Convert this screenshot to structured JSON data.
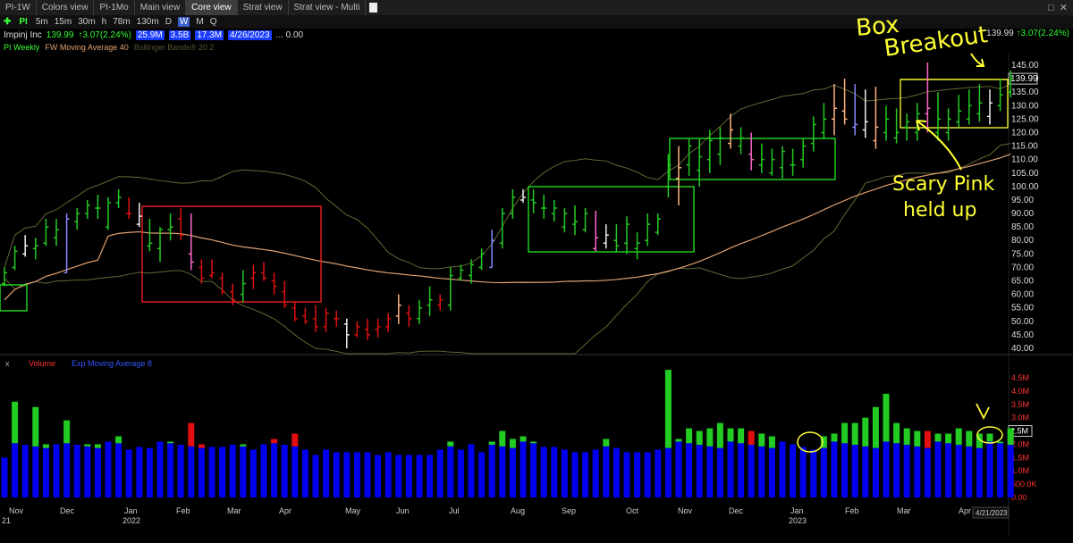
{
  "tabs": [
    "PI-1W",
    "Colors view",
    "PI-1Mo",
    "Main view",
    "Core view",
    "Strat view",
    "Strat view - Multi"
  ],
  "active_tab": 4,
  "toolbar": {
    "symbol": "PI",
    "timeframes": [
      "5m",
      "15m",
      "30m",
      "h",
      "78m",
      "130m",
      "D",
      "W",
      "M",
      "Q"
    ],
    "selected_timeframe": "W"
  },
  "info": {
    "name": "Impinj Inc",
    "last": "139.99",
    "change": "↑3.07(2.24%)",
    "vol1": "25.9M",
    "vol2": "3.5B",
    "vol3": "17.3M",
    "date": "4/26/2023",
    "misc": "... 0.00"
  },
  "indicators_top": [
    "PI Weekly",
    "FW Moving Average 40",
    "Bollinger Bands® 20 2"
  ],
  "indicators_bottom": [
    "Volume",
    "Exp Moving Average 8"
  ],
  "colors": {
    "up": "#22cc22",
    "down": "#e01010",
    "pink": "#ff66cc",
    "peach": "#ffb380",
    "white": "#eeeeee",
    "violet": "#8888ff",
    "ma": "#e0a070",
    "bb": "#666633",
    "annot": "#ffff33",
    "box_red": "#ff2222",
    "box_green": "#22ee22",
    "vol_blue": "#0000ee"
  },
  "annotations": {
    "breakout": "Box Breakout",
    "pink": "Scary Pink held up"
  },
  "chart_data": {
    "type": "ohlc",
    "price_axis": {
      "ticks": [
        "145.00",
        "140.00",
        "135.00",
        "130.00",
        "125.00",
        "120.00",
        "115.00",
        "110.00",
        "105.00",
        "100.00",
        "95.00",
        "90.00",
        "85.00",
        "80.00",
        "75.00",
        "70.00",
        "65.00",
        "60.00",
        "55.00",
        "50.00",
        "45.00",
        "40.00"
      ],
      "ylim": [
        40,
        145
      ],
      "last_label": "139.99"
    },
    "volume_axis": {
      "ticks": [
        "4.5M",
        "4.0M",
        "3.5M",
        "3.0M",
        "2.5M",
        "2.0M",
        "1.5M",
        "1.0M",
        "500.0K",
        "0.00"
      ],
      "ylim": [
        0,
        4.5
      ],
      "last_label": "2.5M"
    },
    "x_labels": [
      "Nov",
      "Dec",
      "Jan",
      "Feb",
      "Mar",
      "Apr",
      "May",
      "Jun",
      "Jul",
      "Aug",
      "Sep",
      "Oct",
      "Nov",
      "Dec",
      "Jan",
      "Feb",
      "Mar",
      "Apr"
    ],
    "x_sublabels": [
      "21",
      "2022",
      "2023"
    ],
    "cursor_date": "4/21/2023",
    "bars": [
      [
        64,
        70,
        63,
        68,
        "up",
        1.5
      ],
      [
        70,
        78,
        69,
        76,
        "up",
        3.6
      ],
      [
        75,
        82,
        74,
        78,
        "white",
        2.0
      ],
      [
        77,
        81,
        73,
        78,
        "up",
        3.4
      ],
      [
        79,
        88,
        78,
        85,
        "up",
        2.0
      ],
      [
        81,
        88,
        78,
        84,
        "up",
        2.0
      ],
      [
        68,
        90,
        68,
        88,
        "violet",
        2.9
      ],
      [
        87,
        92,
        84,
        90,
        "up",
        2.0
      ],
      [
        90,
        95,
        88,
        93,
        "up",
        2.0
      ],
      [
        92,
        97,
        88,
        92,
        "up",
        2.0
      ],
      [
        85,
        96,
        84,
        94,
        "up",
        2.1
      ],
      [
        94,
        99,
        92,
        96,
        "up",
        2.3
      ],
      [
        90,
        96,
        88,
        90,
        "down",
        1.8
      ],
      [
        86,
        94,
        85,
        89,
        "white",
        1.9
      ],
      [
        78,
        88,
        76,
        79,
        "up",
        1.9
      ],
      [
        77,
        85,
        72,
        84,
        "up",
        2.1
      ],
      [
        84,
        90,
        80,
        85,
        "up",
        2.1
      ],
      [
        88,
        92,
        80,
        82,
        "down",
        2.0
      ],
      [
        75,
        90,
        69,
        72,
        "pink",
        2.8
      ],
      [
        70,
        73,
        64,
        66,
        "down",
        2.0
      ],
      [
        67,
        73,
        66,
        68,
        "down",
        1.9
      ],
      [
        66,
        68,
        60,
        61,
        "down",
        1.9
      ],
      [
        61,
        64,
        56,
        58,
        "down",
        2.0
      ],
      [
        60,
        69,
        57,
        64,
        "up",
        2.0
      ],
      [
        66,
        71,
        62,
        68,
        "down",
        1.8
      ],
      [
        68,
        72,
        65,
        66,
        "down",
        2.0
      ],
      [
        65,
        68,
        60,
        63,
        "down",
        2.2
      ],
      [
        61,
        65,
        55,
        56,
        "down",
        2.0
      ],
      [
        55,
        57,
        50,
        51,
        "down",
        2.4
      ],
      [
        52,
        55,
        49,
        50,
        "down",
        1.8
      ],
      [
        51,
        56,
        46,
        48,
        "down",
        1.6
      ],
      [
        48,
        55,
        46,
        53,
        "down",
        1.8
      ],
      [
        51,
        54,
        48,
        51,
        "down",
        1.7
      ],
      [
        49,
        51,
        40,
        45,
        "white",
        1.7
      ],
      [
        45,
        50,
        44,
        48,
        "down",
        1.7
      ],
      [
        47,
        51,
        43,
        45,
        "down",
        1.7
      ],
      [
        47,
        51,
        44,
        48,
        "down",
        1.6
      ],
      [
        48,
        53,
        46,
        51,
        "down",
        1.7
      ],
      [
        52,
        60,
        49,
        56,
        "peach",
        1.6
      ],
      [
        53,
        56,
        48,
        51,
        "down",
        1.6
      ],
      [
        51,
        58,
        49,
        55,
        "up",
        1.6
      ],
      [
        56,
        63,
        52,
        58,
        "up",
        1.6
      ],
      [
        56,
        60,
        54,
        58,
        "down",
        1.8
      ],
      [
        56,
        70,
        54,
        67,
        "up",
        2.1
      ],
      [
        66,
        71,
        65,
        69,
        "up",
        1.8
      ],
      [
        67,
        73,
        64,
        71,
        "up",
        2.0
      ],
      [
        70,
        77,
        69,
        75,
        "up",
        1.7
      ],
      [
        70,
        84,
        70,
        80,
        "violet",
        2.1
      ],
      [
        79,
        92,
        77,
        90,
        "up",
        2.5
      ],
      [
        90,
        99,
        88,
        96,
        "up",
        2.2
      ],
      [
        95,
        99,
        94,
        96,
        "white",
        2.3
      ],
      [
        95,
        99,
        90,
        94,
        "up",
        2.1
      ],
      [
        92,
        97,
        88,
        92,
        "up",
        1.9
      ],
      [
        90,
        95,
        87,
        92,
        "up",
        1.9
      ],
      [
        85,
        92,
        83,
        90,
        "up",
        1.8
      ],
      [
        86,
        93,
        82,
        87,
        "up",
        1.7
      ],
      [
        84,
        92,
        83,
        90,
        "up",
        1.7
      ],
      [
        77,
        91,
        76,
        81,
        "pink",
        1.8
      ],
      [
        79,
        86,
        77,
        82,
        "white",
        2.2
      ],
      [
        80,
        86,
        76,
        78,
        "up",
        1.9
      ],
      [
        79,
        89,
        75,
        86,
        "up",
        1.7
      ],
      [
        77,
        83,
        73,
        79,
        "up",
        1.7
      ],
      [
        80,
        90,
        78,
        86,
        "up",
        1.7
      ],
      [
        83,
        90,
        82,
        88,
        "up",
        1.8
      ],
      [
        100,
        112,
        96,
        108,
        "up",
        4.8
      ],
      [
        103,
        115,
        93,
        107,
        "peach",
        2.2
      ],
      [
        108,
        118,
        104,
        115,
        "up",
        2.6
      ],
      [
        106,
        118,
        100,
        111,
        "up",
        2.5
      ],
      [
        110,
        121,
        105,
        117,
        "up",
        2.6
      ],
      [
        112,
        122,
        108,
        118,
        "up",
        2.8
      ],
      [
        116,
        127,
        114,
        121,
        "peach",
        2.6
      ],
      [
        115,
        122,
        112,
        118,
        "up",
        2.6
      ],
      [
        112,
        120,
        106,
        110,
        "pink",
        2.5
      ],
      [
        108,
        116,
        105,
        110,
        "up",
        2.4
      ],
      [
        105,
        114,
        104,
        110,
        "up",
        2.3
      ],
      [
        107,
        115,
        103,
        113,
        "up",
        2.1
      ],
      [
        108,
        114,
        104,
        108,
        "up",
        2.0
      ],
      [
        110,
        118,
        107,
        115,
        "up",
        1.9
      ],
      [
        116,
        126,
        113,
        123,
        "up",
        1.8
      ],
      [
        120,
        131,
        118,
        125,
        "up",
        2.3
      ],
      [
        125,
        138,
        119,
        129,
        "peach",
        2.4
      ],
      [
        128,
        140,
        123,
        125,
        "peach",
        2.8
      ],
      [
        122,
        138,
        119,
        123,
        "violet",
        2.8
      ],
      [
        121,
        136,
        118,
        124,
        "white",
        3.0
      ],
      [
        117,
        137,
        114,
        122,
        "peach",
        3.4
      ],
      [
        120,
        130,
        117,
        125,
        "up",
        3.9
      ],
      [
        118,
        129,
        116,
        120,
        "up",
        2.8
      ],
      [
        122,
        127,
        117,
        124,
        "up",
        2.6
      ],
      [
        120,
        131,
        117,
        127,
        "up",
        2.5
      ],
      [
        127,
        146,
        120,
        129,
        "pink",
        2.5
      ],
      [
        120,
        135,
        117,
        125,
        "up",
        2.4
      ],
      [
        120,
        129,
        117,
        125,
        "up",
        2.4
      ],
      [
        124,
        134,
        122,
        128,
        "up",
        2.6
      ],
      [
        125,
        136,
        123,
        130,
        "up",
        2.5
      ],
      [
        127,
        138,
        124,
        131,
        "up",
        2.4
      ],
      [
        126,
        136,
        123,
        131,
        "white",
        2.4
      ],
      [
        130,
        140,
        128,
        134,
        "up",
        2.1
      ],
      [
        135,
        143,
        133,
        140,
        "up",
        2.6
      ]
    ]
  }
}
